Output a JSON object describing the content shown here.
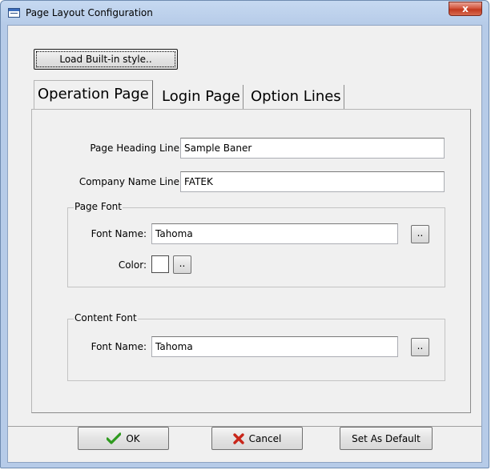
{
  "window": {
    "title": "Page Layout Configuration",
    "close_glyph": "x"
  },
  "load_button": {
    "label": "Load Built-in style.."
  },
  "tabs": [
    {
      "label": "Operation Page",
      "active": true
    },
    {
      "label": "Login Page",
      "active": false
    },
    {
      "label": "Option Lines",
      "active": false
    }
  ],
  "form": {
    "page_heading": {
      "label": "Page Heading Line:",
      "value": "Sample Baner"
    },
    "company_name": {
      "label": "Company Name Line:",
      "value": "FATEK"
    }
  },
  "page_font": {
    "group_title": "Page Font",
    "font_name_label": "Font Name:",
    "font_name_value": "Tahoma",
    "browse_label": "..",
    "color_label": "Color:",
    "color_value": "#ffffff",
    "color_browse_label": ".."
  },
  "content_font": {
    "group_title": "Content Font",
    "font_name_label": "Font Name:",
    "font_name_value": "Tahoma",
    "browse_label": ".."
  },
  "footer": {
    "ok_label": "OK",
    "ok_icon": "check-icon",
    "ok_icon_color": "#2e9a1e",
    "cancel_label": "Cancel",
    "cancel_icon": "x-icon",
    "cancel_icon_color": "#c8261a",
    "default_label": "Set As Default"
  }
}
